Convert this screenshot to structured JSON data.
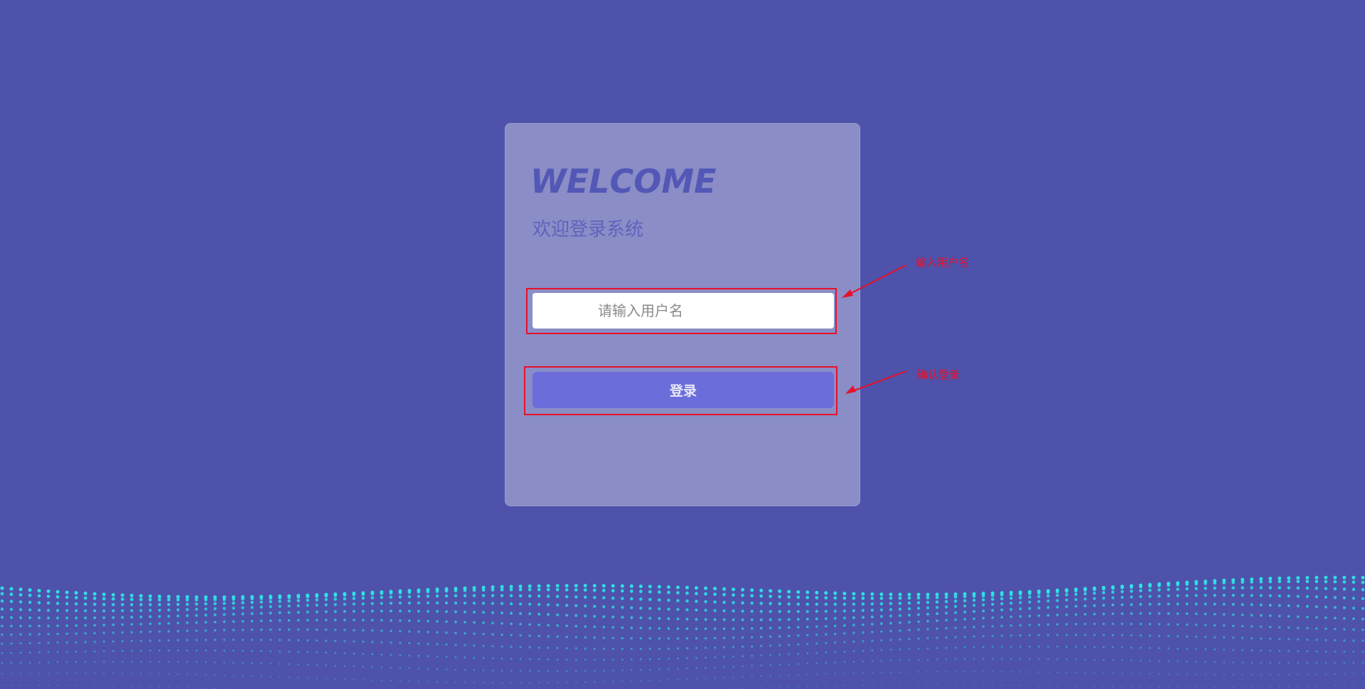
{
  "login": {
    "title": "WELCOME",
    "subtitle": "欢迎登录系统",
    "username_placeholder": "请输入用户名",
    "username_value": "",
    "submit_label": "登录"
  },
  "annotations": {
    "input_note": "输入用户名",
    "button_note": "确认登录"
  },
  "colors": {
    "background": "#4e52ab",
    "card": "#8a8dc6",
    "title": "#5357b6",
    "button": "#6b6ddb",
    "annotation": "#e8102a",
    "particles": "#2ee6e6"
  }
}
